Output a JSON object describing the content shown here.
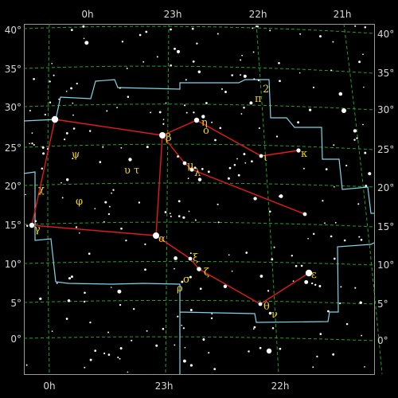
{
  "map": {
    "ra_labels_top": [
      "0h",
      "23h",
      "22h",
      "21h"
    ],
    "ra_labels_bottom": [
      "0h",
      "23h",
      "22h"
    ],
    "dec_labels": [
      "40°",
      "35°",
      "30°",
      "25°",
      "20°",
      "15°",
      "10°",
      "5°",
      "0°"
    ],
    "colors": {
      "background": "#000000",
      "grid": "#22a322",
      "boundary": "#7fd6e8",
      "asterism": "#e31b1b",
      "greek_labels": "#f2d21b",
      "stars": "#ffffff"
    },
    "greek_letters": [
      {
        "id": "alpha",
        "glyph": "α"
      },
      {
        "id": "beta",
        "glyph": "β"
      },
      {
        "id": "gamma",
        "glyph": "γ"
      },
      {
        "id": "epsilon",
        "glyph": "ε"
      },
      {
        "id": "zeta",
        "glyph": "ζ"
      },
      {
        "id": "eta",
        "glyph": "η"
      },
      {
        "id": "omicron",
        "glyph": "ο"
      },
      {
        "id": "iota",
        "glyph": "ι"
      },
      {
        "id": "kappa",
        "glyph": "κ"
      },
      {
        "id": "lambda",
        "glyph": "λ"
      },
      {
        "id": "mu",
        "glyph": "μ"
      },
      {
        "id": "xi",
        "glyph": "ξ"
      },
      {
        "id": "theta",
        "glyph": "θ"
      },
      {
        "id": "nu",
        "glyph": "ν"
      },
      {
        "id": "chi",
        "glyph": "χ"
      },
      {
        "id": "psi",
        "glyph": "ψ"
      },
      {
        "id": "phi",
        "glyph": "φ"
      },
      {
        "id": "upsilon",
        "glyph": "υ"
      },
      {
        "id": "tau",
        "glyph": "τ"
      },
      {
        "id": "sigma",
        "glyph": "σ"
      },
      {
        "id": "rho",
        "glyph": "ρ"
      },
      {
        "id": "pi",
        "glyph": "π"
      },
      {
        "id": "two",
        "glyph": "2"
      }
    ]
  }
}
